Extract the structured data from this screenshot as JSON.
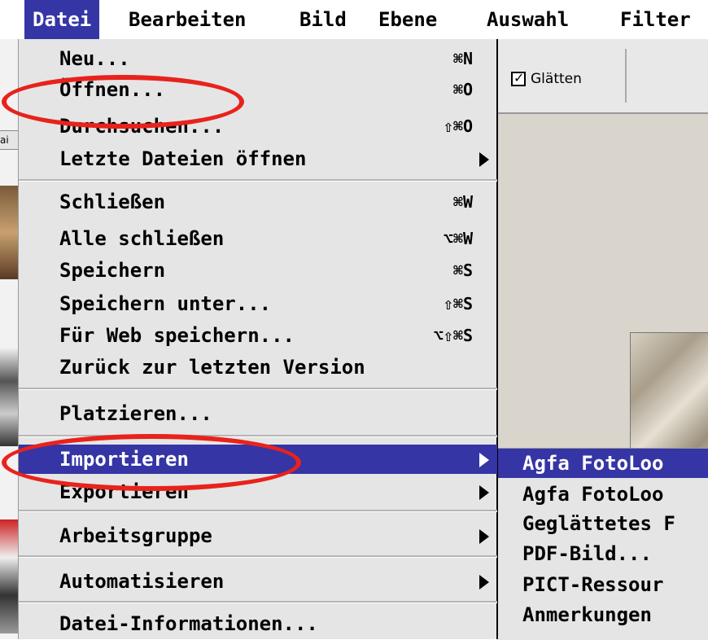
{
  "menubar": {
    "items": [
      "Datei",
      "Bearbeiten",
      "Bild",
      "Ebene",
      "Auswahl",
      "Filter"
    ]
  },
  "options_bar": {
    "smoothing_label": "Glätten",
    "smoothing_checked": true
  },
  "left_strip": {
    "partial_text": "ai"
  },
  "file_menu": {
    "items": [
      {
        "label": "Neu...",
        "shortcut": "⌘N"
      },
      {
        "label": "Öffnen...",
        "shortcut": "⌘O"
      },
      {
        "label": "Durchsuchen...",
        "shortcut": "⇧⌘O"
      },
      {
        "label": "Letzte Dateien öffnen",
        "shortcut": ""
      },
      {
        "label": "Schließen",
        "shortcut": "⌘W"
      },
      {
        "label": "Alle schließen",
        "shortcut": "⌥⌘W"
      },
      {
        "label": "Speichern",
        "shortcut": "⌘S"
      },
      {
        "label": "Speichern unter...",
        "shortcut": "⇧⌘S"
      },
      {
        "label": "Für Web speichern...",
        "shortcut": "⌥⇧⌘S"
      },
      {
        "label": "Zurück zur letzten Version",
        "shortcut": ""
      },
      {
        "label": "Platzieren...",
        "shortcut": ""
      },
      {
        "label": "Importieren",
        "shortcut": ""
      },
      {
        "label": "Exportieren",
        "shortcut": ""
      },
      {
        "label": "Arbeitsgruppe",
        "shortcut": ""
      },
      {
        "label": "Automatisieren",
        "shortcut": ""
      },
      {
        "label": "Datei-Informationen...",
        "shortcut": ""
      }
    ]
  },
  "import_submenu": {
    "items": [
      {
        "label": "Agfa FotoLoo"
      },
      {
        "label": "Agfa FotoLoo"
      },
      {
        "label": "Geglättetes F"
      },
      {
        "label": "PDF-Bild..."
      },
      {
        "label": "PICT-Ressour"
      },
      {
        "label": "Anmerkungen"
      }
    ]
  },
  "colors": {
    "highlight": "#3535a5",
    "annotation": "#e8221c",
    "menu_bg": "#e5e5e5"
  }
}
